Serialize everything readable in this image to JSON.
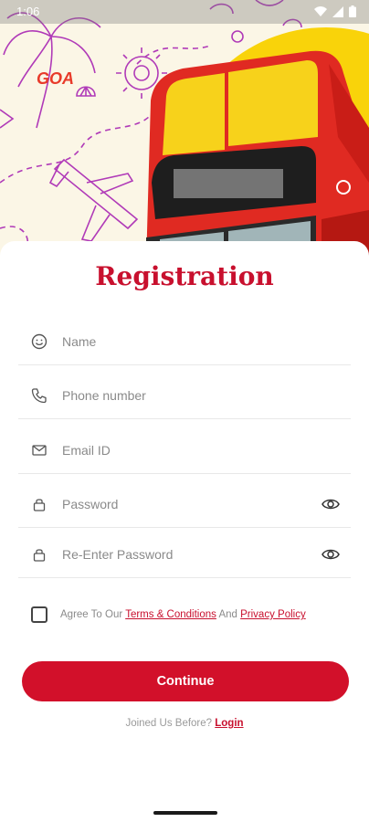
{
  "status": {
    "time": "1:06"
  },
  "brand": {
    "logo_text": "GOA"
  },
  "form": {
    "title": "Registration",
    "fields": [
      {
        "icon": "smile-icon",
        "placeholder": "Name"
      },
      {
        "icon": "phone-icon",
        "placeholder": "Phone number"
      },
      {
        "icon": "mail-icon",
        "placeholder": "Email ID"
      },
      {
        "icon": "lock-icon",
        "placeholder": "Password",
        "toggle": "eye-icon"
      },
      {
        "icon": "lock-icon",
        "placeholder": "Re-Enter Password",
        "toggle": "eye-icon"
      }
    ],
    "agree": {
      "prefix": "Agree To Our ",
      "terms": "Terms & Conditions",
      "middle": " And ",
      "privacy": "Privacy Policy",
      "checked": false
    },
    "continue_label": "Continue",
    "login_prompt": "Joined Us Before? ",
    "login_link": "Login"
  },
  "colors": {
    "accent": "#d2102a",
    "sun": "#f9d30a",
    "bus": "#e02a22",
    "doodle": "#b03ab8"
  }
}
